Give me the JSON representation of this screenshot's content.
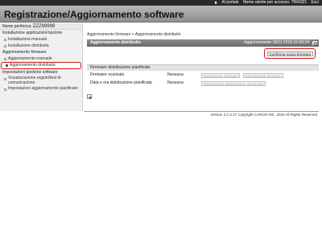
{
  "topbar": {
    "portal_label": "Al portale",
    "access_label": "Nome utente per accesso: 7654321",
    "logout_label": "Esci"
  },
  "header": {
    "title": "Registrazione/Aggiornamento software"
  },
  "sidebar": {
    "device_label": "Nome periferica:",
    "device_value": "ZZZ99999",
    "sections": [
      {
        "label": "Installazione applicazioni/opzione",
        "items": [
          {
            "label": "Installazione manuale"
          },
          {
            "label": "Installazione distribuita"
          }
        ]
      },
      {
        "label": "Aggiornamento firmware",
        "items": [
          {
            "label": "Aggiornamento manuale"
          },
          {
            "label": "Aggiornamento distribuito",
            "active": true
          }
        ]
      },
      {
        "label": "Impostazioni gestione software",
        "items": [
          {
            "label": "Visualizzazione registri/test di comunicazione"
          },
          {
            "label": "Impostazioni aggiornamento pianificato"
          }
        ]
      }
    ]
  },
  "content": {
    "breadcrumb": "Aggiornamento firmware > Aggiornamento distribuito",
    "panel_title": "Aggiornamento distribuito",
    "panel_date_prefix": "Aggiornamento",
    "panel_date": "18/11 2015 22:59:24",
    "confirm_button": "Conferma nuovo firmware",
    "section_title": "Firmware distribuzione pianificata",
    "rows": [
      {
        "label": "Firmware scaricato",
        "value": "Nessuna",
        "btn_a": "Applicazione firmware",
        "btn_b": "Eliminazione firmware"
      },
      {
        "label": "Data e ora distribuzione pianificata",
        "value": "Nessuna",
        "btn_a": "Eliminazione distribuzione pianificata"
      }
    ]
  },
  "footer": {
    "text": "Version 3.1.3.17 Copyright CANON INC. 2015 All Rights Reserved"
  },
  "colors": {
    "highlight": "#d01515",
    "header": "#a3a3a3",
    "panel": "#7a7a7a"
  },
  "icons": {
    "portal": "house-icon",
    "refresh": "refresh-icon",
    "top": "page-top-icon"
  }
}
